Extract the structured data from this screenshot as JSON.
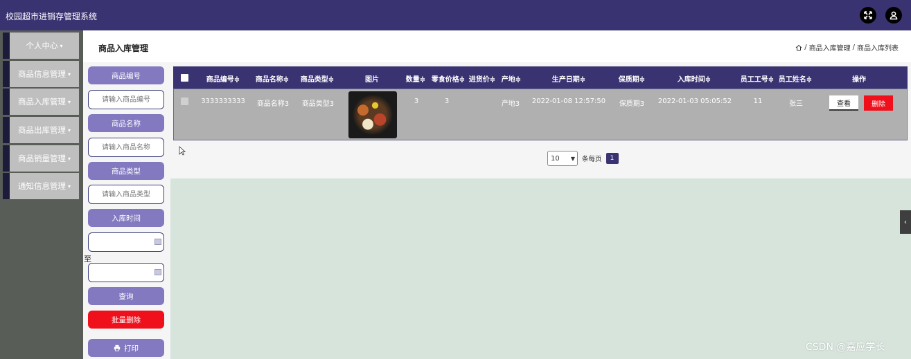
{
  "app": {
    "title": "校园超市进销存管理系统"
  },
  "sidebar": {
    "items": [
      {
        "label": "个人中心"
      },
      {
        "label": "商品信息管理"
      },
      {
        "label": "商品入库管理"
      },
      {
        "label": "商品出库管理"
      },
      {
        "label": "商品销量管理"
      },
      {
        "label": "通知信息管理"
      }
    ],
    "caret": "▾"
  },
  "header": {
    "title": "商品入库管理",
    "breadcrumb": [
      "商品入库管理",
      "商品入库列表"
    ],
    "breadcrumb_sep": "/"
  },
  "search": {
    "goods_no_label": "商品编号",
    "goods_no_placeholder": "请输入商品编号",
    "goods_name_label": "商品名称",
    "goods_name_placeholder": "请输入商品名称",
    "goods_type_label": "商品类型",
    "goods_type_placeholder": "请输入商品类型",
    "in_time_label": "入库时间",
    "to_label": "至",
    "query_button": "查询",
    "batch_delete_button": "批量删除",
    "print_button": "打印"
  },
  "table": {
    "sort_mark": "≑",
    "columns": [
      "商品编号",
      "商品名称",
      "商品类型",
      "图片",
      "数量",
      "零食价格",
      "进货价",
      "产地",
      "生产日期",
      "保质期",
      "入库时间",
      "员工工号",
      "员工姓名",
      "操作"
    ],
    "rows": [
      {
        "goods_no": "3333333333",
        "goods_name": "商品名称3",
        "goods_type": "商品类型3",
        "quantity": "3",
        "snack_price": "3",
        "purchase_price": "",
        "origin": "产地3",
        "production_date": "2022-01-08 12:57:50",
        "shelf_life": "保质期3",
        "in_time": "2022-01-03 05:05:52",
        "staff_no": "11",
        "staff_name": "张三",
        "view_label": "查看",
        "delete_label": "删除"
      }
    ]
  },
  "pagination": {
    "page_size": "10",
    "per_page_label": "条每页",
    "current_page": "1"
  },
  "watermark": "CSDN @嘉应学长",
  "colors": {
    "primary": "#3a3372",
    "button": "#8279c1",
    "danger": "#f0101c",
    "sidebar": "#585d58",
    "body": "#d6e4dc"
  }
}
